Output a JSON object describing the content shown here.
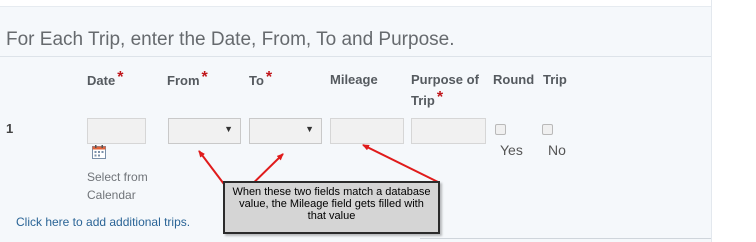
{
  "section": {
    "title": "For Each Trip, enter the Date, From, To and Purpose."
  },
  "columns": {
    "date": "Date",
    "from": "From",
    "to": "To",
    "mileage": "Mileage",
    "purpose_line1": "Purpose of",
    "purpose_line2": "Trip",
    "round": "Round",
    "trip": "Trip",
    "required_marker": "*"
  },
  "row": {
    "number": "1",
    "date_value": "",
    "from_value": "",
    "to_value": "",
    "mileage_value": "",
    "purpose_value": "",
    "yes_label": "Yes",
    "no_label": "No",
    "calendar_line1": "Select from",
    "calendar_line2": "Calendar"
  },
  "add_trips_link": "Click here to add additional trips.",
  "annotation": {
    "text": "When these two fields match a database value, the Mileage field gets filled with that value",
    "arrow_color": "#e01b1b"
  },
  "icons": {
    "calendar": "calendar-icon",
    "caret": "caret-down-icon"
  }
}
